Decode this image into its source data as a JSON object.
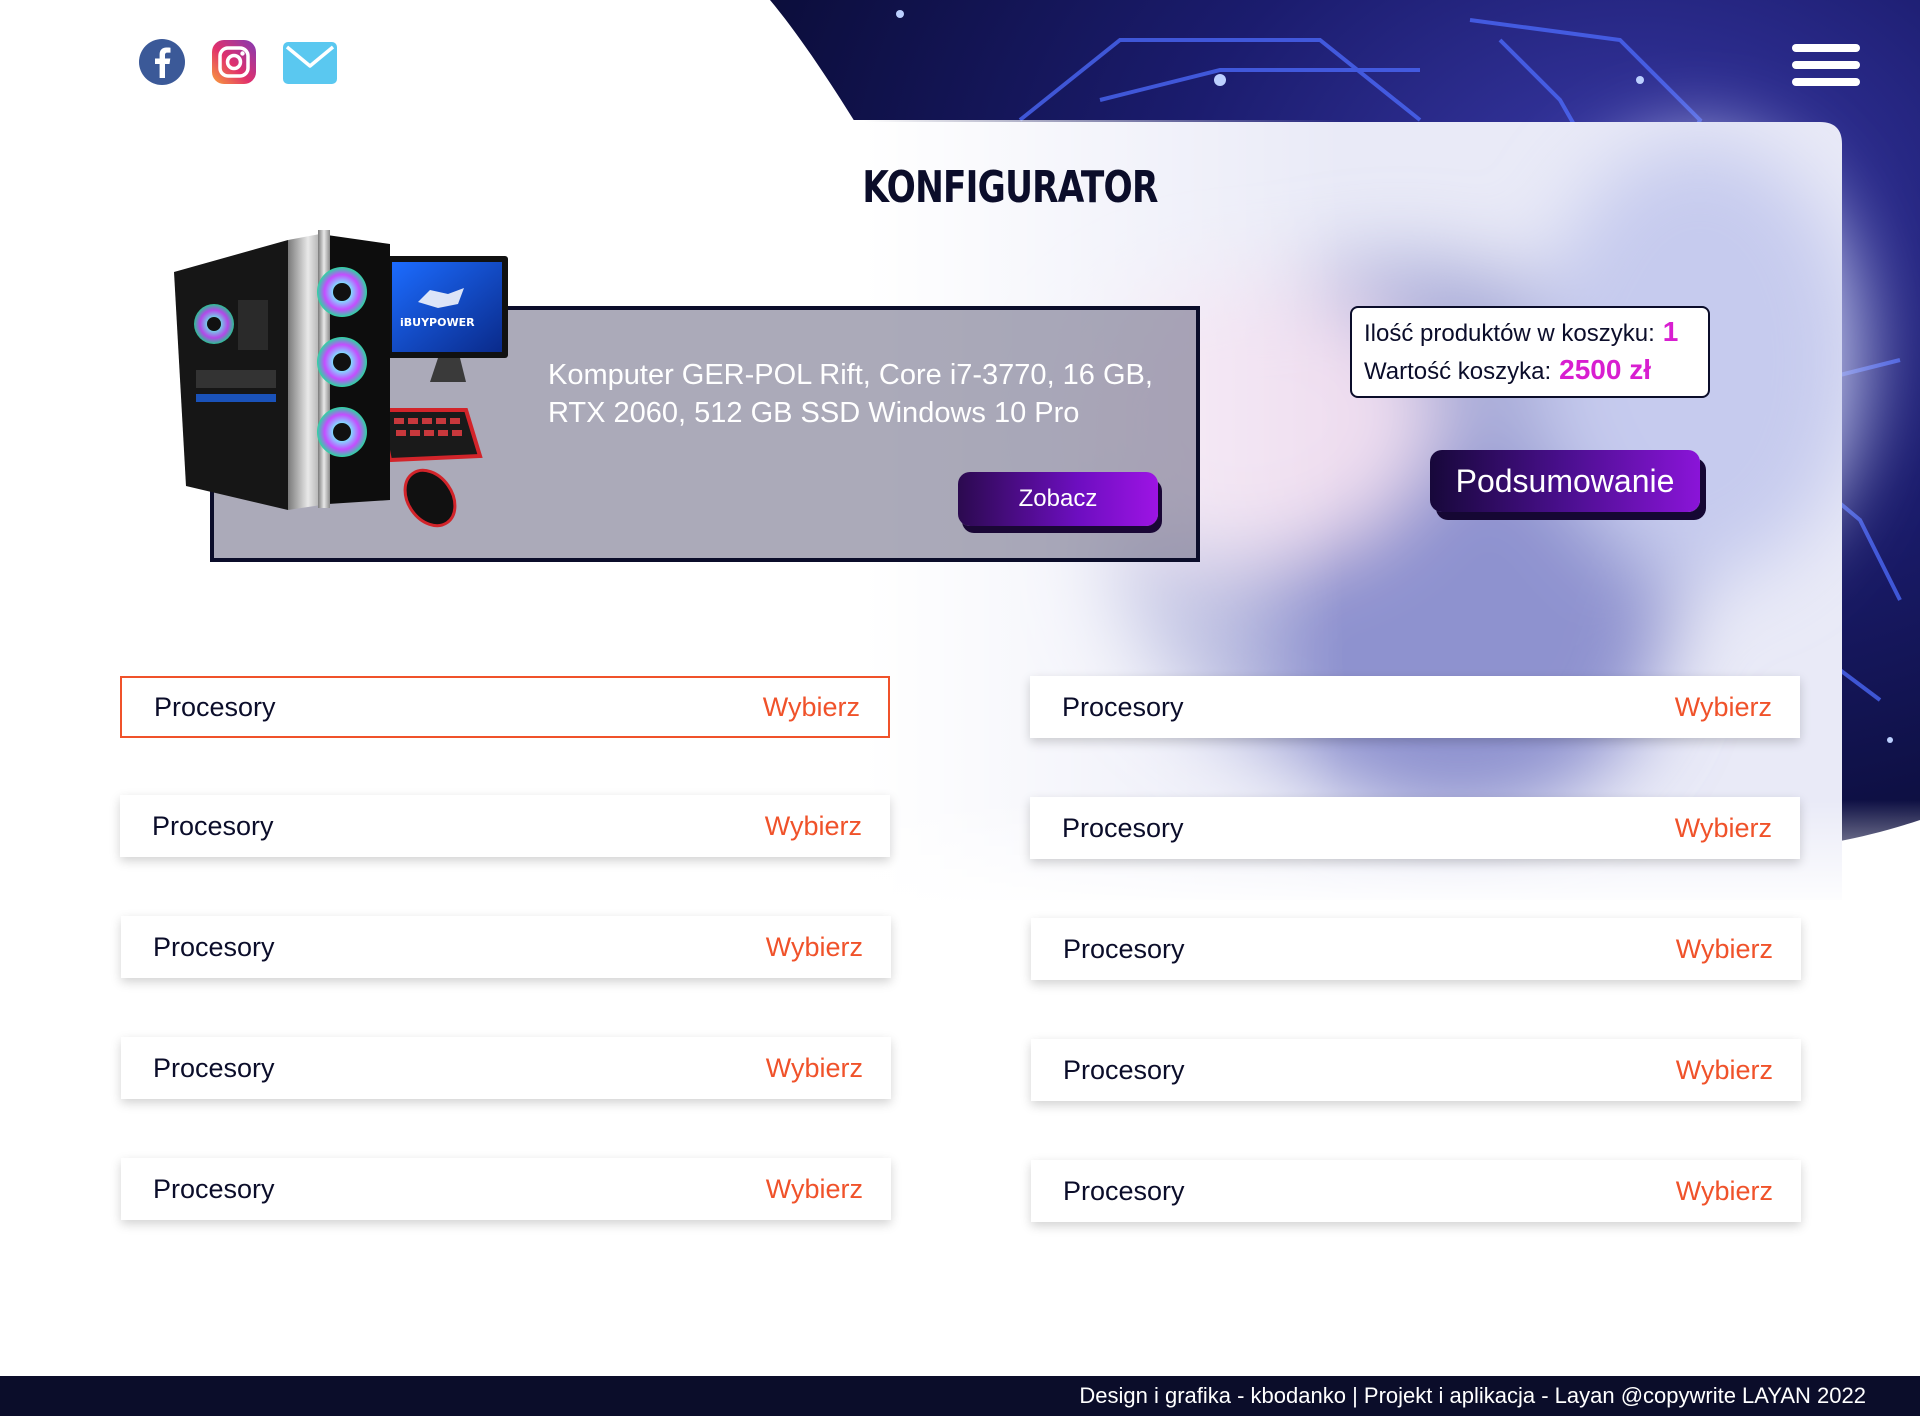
{
  "header": {
    "social_icons": [
      "facebook-icon",
      "instagram-icon",
      "mail-icon"
    ],
    "menu_icon": "hamburger-menu-icon"
  },
  "page": {
    "title": "KONFIGURATOR"
  },
  "featured": {
    "product_name": "Komputer GER-POL Rift, Core i7-3770, 16 GB, RTX 2060, 512 GB SSD Windows 10 Pro",
    "button_label": "Zobacz",
    "image": "gaming-pc-set-icon",
    "brand": "iBUYPOWER"
  },
  "cart": {
    "count_label": "Ilość produktów w koszyku:",
    "count_value": "1",
    "total_label": "Wartość koszyka:",
    "total_value": "2500 zł"
  },
  "summary_button": "Podsumowanie",
  "categories": [
    {
      "label": "Procesory",
      "action": "Wybierz"
    },
    {
      "label": "Procesory",
      "action": "Wybierz"
    },
    {
      "label": "Procesory",
      "action": "Wybierz"
    },
    {
      "label": "Procesory",
      "action": "Wybierz"
    },
    {
      "label": "Procesory",
      "action": "Wybierz"
    },
    {
      "label": "Procesory",
      "action": "Wybierz"
    },
    {
      "label": "Procesory",
      "action": "Wybierz"
    },
    {
      "label": "Procesory",
      "action": "Wybierz"
    },
    {
      "label": "Procesory",
      "action": "Wybierz"
    },
    {
      "label": "Procesory",
      "action": "Wybierz"
    }
  ],
  "footer": {
    "text": "Design i grafika - kbodanko | Projekt i aplikacja - Layan  @copywrite LAYAN 2022"
  },
  "colors": {
    "navy": "#0b0d2a",
    "accent_orange": "#f0522a",
    "accent_magenta": "#d81ed0",
    "button_purple": "#6d0ec0"
  }
}
